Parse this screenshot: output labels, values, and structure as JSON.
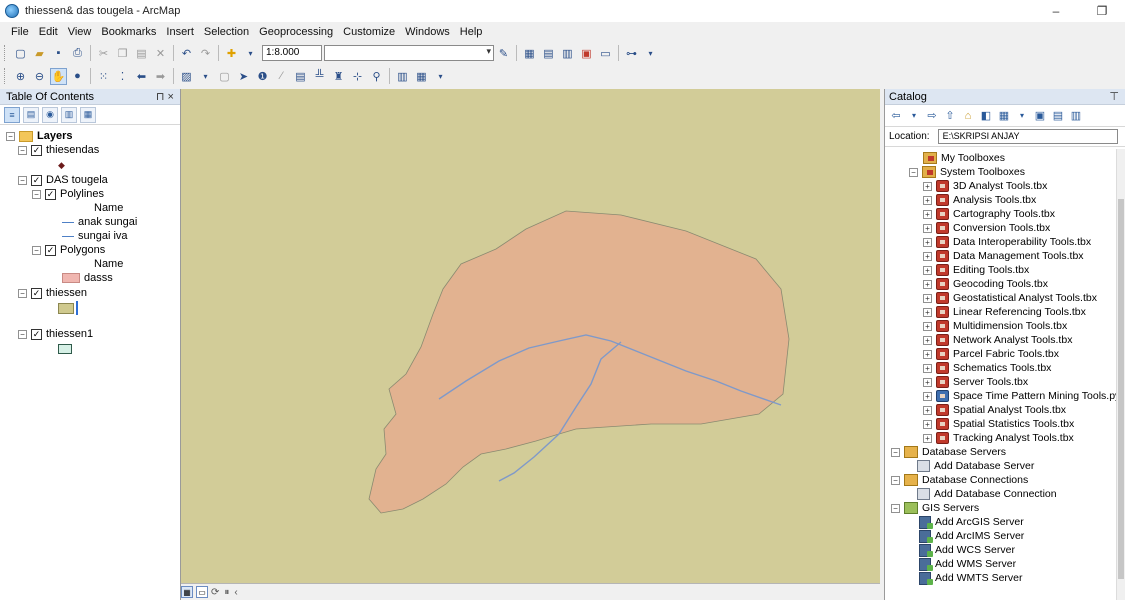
{
  "window": {
    "title": "thiessen& das tougela - ArcMap",
    "minimize": "–",
    "maximize": "❐"
  },
  "menu": [
    "File",
    "Edit",
    "View",
    "Bookmarks",
    "Insert",
    "Selection",
    "Geoprocessing",
    "Customize",
    "Windows",
    "Help"
  ],
  "toolbar": {
    "scale": "1:8.000"
  },
  "toc": {
    "title": "Table Of Contents",
    "pin": "⊓ ×",
    "tree": [
      {
        "label": "Layers",
        "bold": true
      },
      {
        "label": "thiesendas"
      },
      {
        "label": "DAS tougela"
      },
      {
        "label": "Polylines"
      },
      {
        "label": "Name"
      },
      {
        "label": "anak sungai"
      },
      {
        "label": "sungai iva"
      },
      {
        "label": "Polygons"
      },
      {
        "label": "Name"
      },
      {
        "label": "dasss"
      },
      {
        "label": "thiessen"
      },
      {
        "label": "thiessen1"
      }
    ]
  },
  "colors": {
    "map_background": "#d2cc98",
    "watershed_fill": "#e2b290",
    "river": "#7f99c9",
    "toc_header": "#dde6f2"
  },
  "catalog": {
    "title": "Catalog",
    "location_label": "Location:",
    "location_value": "E:\\SKRIPSI ANJAY",
    "items": [
      "My Toolboxes",
      "System Toolboxes",
      "3D Analyst Tools.tbx",
      "Analysis Tools.tbx",
      "Cartography Tools.tbx",
      "Conversion Tools.tbx",
      "Data Interoperability Tools.tbx",
      "Data Management Tools.tbx",
      "Editing Tools.tbx",
      "Geocoding Tools.tbx",
      "Geostatistical Analyst Tools.tbx",
      "Linear Referencing Tools.tbx",
      "Multidimension Tools.tbx",
      "Network Analyst Tools.tbx",
      "Parcel Fabric Tools.tbx",
      "Schematics Tools.tbx",
      "Server Tools.tbx",
      "Space Time Pattern Mining Tools.pyt",
      "Spatial Analyst Tools.tbx",
      "Spatial Statistics Tools.tbx",
      "Tracking Analyst Tools.tbx",
      "Database Servers",
      "Add Database Server",
      "Database Connections",
      "Add Database Connection",
      "GIS Servers",
      "Add ArcGIS Server",
      "Add ArcIMS Server",
      "Add WCS Server",
      "Add WMS Server",
      "Add WMTS Server"
    ]
  }
}
